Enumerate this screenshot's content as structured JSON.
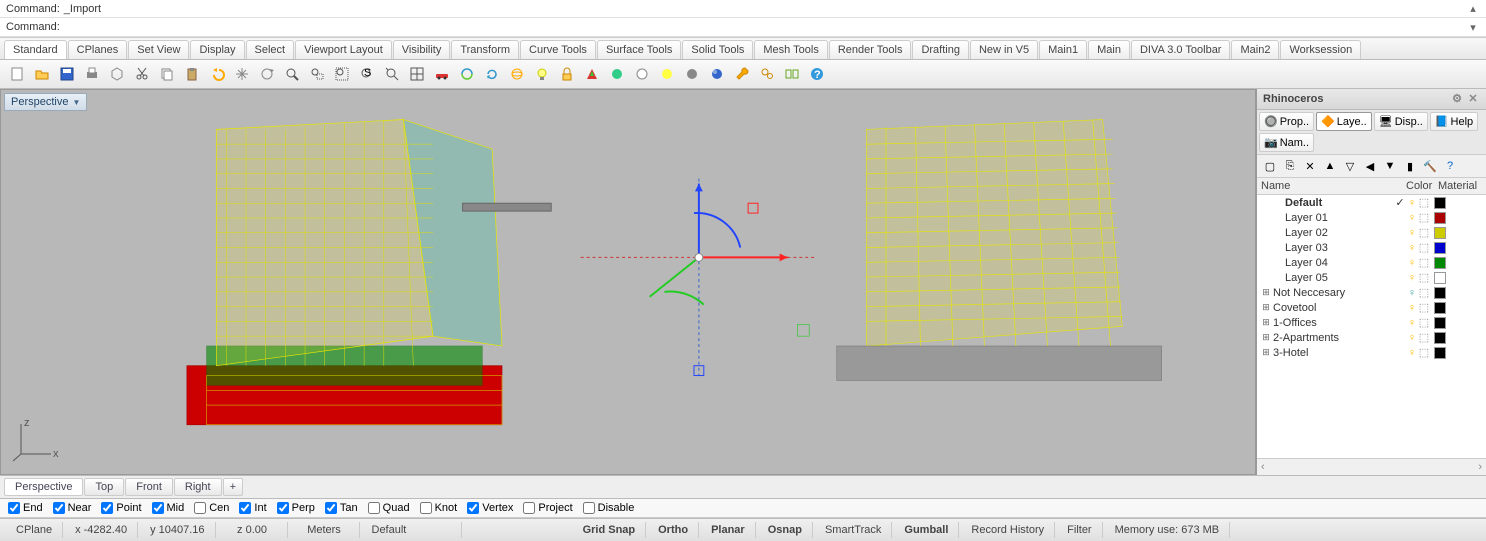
{
  "command": {
    "label1": "Command:",
    "text1": "_Import",
    "label2": "Command:",
    "value2": ""
  },
  "tabs": [
    "Standard",
    "CPlanes",
    "Set View",
    "Display",
    "Select",
    "Viewport Layout",
    "Visibility",
    "Transform",
    "Curve Tools",
    "Surface Tools",
    "Solid Tools",
    "Mesh Tools",
    "Render Tools",
    "Drafting",
    "New in V5",
    "Main1",
    "Main",
    "DIVA 3.0 Toolbar",
    "Main2",
    "Worksession"
  ],
  "viewport": {
    "label": "Perspective"
  },
  "panel": {
    "title": "Rhinoceros",
    "tabs": [
      {
        "label": "Prop..",
        "icon": "props"
      },
      {
        "label": "Laye..",
        "icon": "layers",
        "active": true
      },
      {
        "label": "Disp..",
        "icon": "display"
      },
      {
        "label": "Help",
        "icon": "help"
      },
      {
        "label": "Nam..",
        "icon": "cam"
      }
    ],
    "columns": {
      "name": "Name",
      "color": "Color",
      "material": "Material"
    }
  },
  "layers": [
    {
      "name": "Default",
      "bold": true,
      "current": true,
      "color": "#000000",
      "indent": 1
    },
    {
      "name": "Layer 01",
      "color": "#aa0000",
      "indent": 1
    },
    {
      "name": "Layer 02",
      "color": "#cccc00",
      "indent": 1
    },
    {
      "name": "Layer 03",
      "color": "#0000cc",
      "indent": 1
    },
    {
      "name": "Layer 04",
      "color": "#008800",
      "indent": 1
    },
    {
      "name": "Layer 05",
      "color": "#ffffff",
      "indent": 1
    },
    {
      "name": "Not Neccesary",
      "color": "#000000",
      "indent": 0,
      "exp": "+",
      "bulb": "#4aa"
    },
    {
      "name": "Covetool",
      "color": "#000000",
      "indent": 0,
      "exp": "+"
    },
    {
      "name": "1-Offices",
      "color": "#000000",
      "indent": 0,
      "exp": "+"
    },
    {
      "name": "2-Apartments",
      "color": "#000000",
      "indent": 0,
      "exp": "+"
    },
    {
      "name": "3-Hotel",
      "color": "#000000",
      "indent": 0,
      "exp": "+"
    }
  ],
  "viewtabs": [
    "Perspective",
    "Top",
    "Front",
    "Right"
  ],
  "osnaps": [
    {
      "label": "End",
      "on": true
    },
    {
      "label": "Near",
      "on": true
    },
    {
      "label": "Point",
      "on": true
    },
    {
      "label": "Mid",
      "on": true
    },
    {
      "label": "Cen",
      "on": false
    },
    {
      "label": "Int",
      "on": true
    },
    {
      "label": "Perp",
      "on": true
    },
    {
      "label": "Tan",
      "on": true
    },
    {
      "label": "Quad",
      "on": false
    },
    {
      "label": "Knot",
      "on": false
    },
    {
      "label": "Vertex",
      "on": true
    },
    {
      "label": "Project",
      "on": false
    },
    {
      "label": "Disable",
      "on": false
    }
  ],
  "status": {
    "cplane": "CPlane",
    "x": "x -4282.40",
    "y": "y 10407.16",
    "z": "z 0.00",
    "units": "Meters",
    "layer": "Default",
    "gridsnap": "Grid Snap",
    "ortho": "Ortho",
    "planar": "Planar",
    "osnap": "Osnap",
    "smarttrack": "SmartTrack",
    "gumball": "Gumball",
    "history": "Record History",
    "filter": "Filter",
    "memory": "Memory use: 673 MB"
  },
  "toolbar_icons": [
    "new",
    "open",
    "save",
    "print",
    "3d",
    "cut",
    "copy",
    "paste",
    "undo",
    "pan",
    "rotate",
    "zoom",
    "zoomwin",
    "zoomext",
    "zoomsel",
    "zoomall",
    "grid",
    "car",
    "cycle",
    "refresh",
    "world",
    "bulb",
    "lock",
    "paint",
    "shade1",
    "shade2",
    "shade3",
    "shade4",
    "sphere",
    "wrench",
    "gears",
    "unwrap",
    "help"
  ]
}
